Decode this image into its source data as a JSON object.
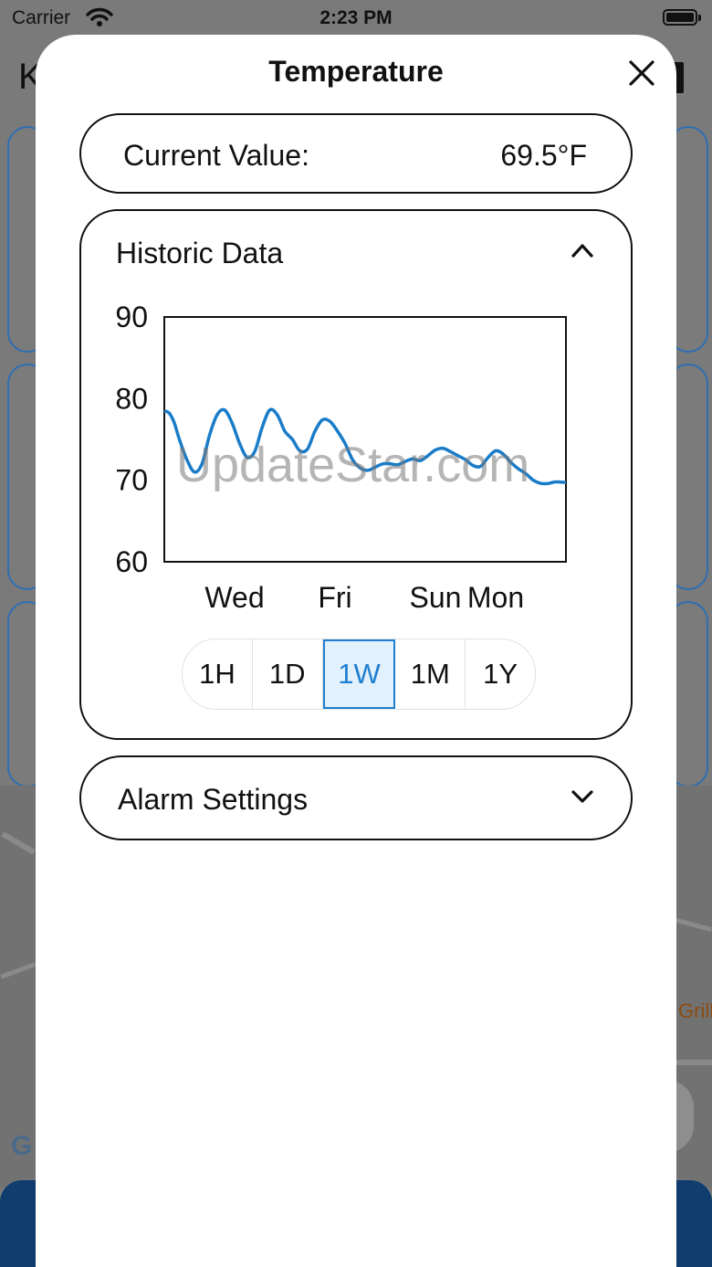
{
  "status_bar": {
    "carrier": "Carrier",
    "time": "2:23 PM"
  },
  "background": {
    "title_initial": "K",
    "map_label": "Grill"
  },
  "modal": {
    "title": "Temperature",
    "close_icon": "close-icon"
  },
  "current_value": {
    "label": "Current Value:",
    "value": "69.5°F"
  },
  "historic": {
    "title": "Historic Data",
    "toggle_icon": "chevron-up-icon",
    "ranges": [
      "1H",
      "1D",
      "1W",
      "1M",
      "1Y"
    ],
    "selected_range": "1W"
  },
  "watermark": "UpdateStar.com",
  "alarm": {
    "label": "Alarm Settings",
    "toggle_icon": "chevron-down-icon"
  },
  "colors": {
    "accent": "#1f7fd0",
    "line": "#1a7cc8",
    "selected_bg": "#e3f1fd"
  },
  "chart_data": {
    "type": "line",
    "ylim": [
      60,
      90
    ],
    "yticks": [
      60,
      70,
      80,
      90
    ],
    "xticks": [
      {
        "label": "Wed",
        "x": 1.4
      },
      {
        "label": "Fri",
        "x": 3.4
      },
      {
        "label": "Sun",
        "x": 5.4
      },
      {
        "label": "Mon",
        "x": 6.6
      }
    ],
    "xlim": [
      0,
      8
    ],
    "series": [
      {
        "x": [
          0.0,
          0.1,
          0.2,
          0.3,
          0.45,
          0.6,
          0.75,
          0.9,
          1.05,
          1.2,
          1.35,
          1.5,
          1.65,
          1.8,
          1.95,
          2.1,
          2.25,
          2.4,
          2.55,
          2.7,
          2.85,
          3.0,
          3.15,
          3.3,
          3.45,
          3.6,
          3.75,
          3.9,
          4.05,
          4.2,
          4.35,
          4.5,
          4.65,
          4.8,
          4.95,
          5.1,
          5.25,
          5.4,
          5.55,
          5.7,
          5.85,
          6.0,
          6.15,
          6.3,
          6.45,
          6.6,
          6.75,
          6.9,
          7.05,
          7.2,
          7.35,
          7.5,
          7.65,
          7.8,
          8.0
        ],
        "y": [
          78.5,
          78.2,
          77.0,
          75.0,
          72.5,
          71.0,
          72.0,
          75.5,
          78.0,
          78.6,
          77.0,
          74.5,
          72.8,
          73.5,
          76.5,
          78.6,
          78.0,
          76.0,
          75.0,
          73.6,
          73.8,
          76.0,
          77.4,
          77.2,
          76.0,
          74.5,
          72.5,
          71.5,
          71.2,
          71.6,
          72.0,
          72.0,
          71.9,
          72.3,
          72.6,
          72.4,
          73.0,
          73.7,
          73.9,
          73.5,
          73.0,
          72.5,
          71.8,
          71.7,
          72.8,
          73.6,
          73.2,
          72.2,
          71.4,
          70.8,
          70.0,
          69.6,
          69.6,
          69.8,
          69.7
        ]
      }
    ]
  }
}
